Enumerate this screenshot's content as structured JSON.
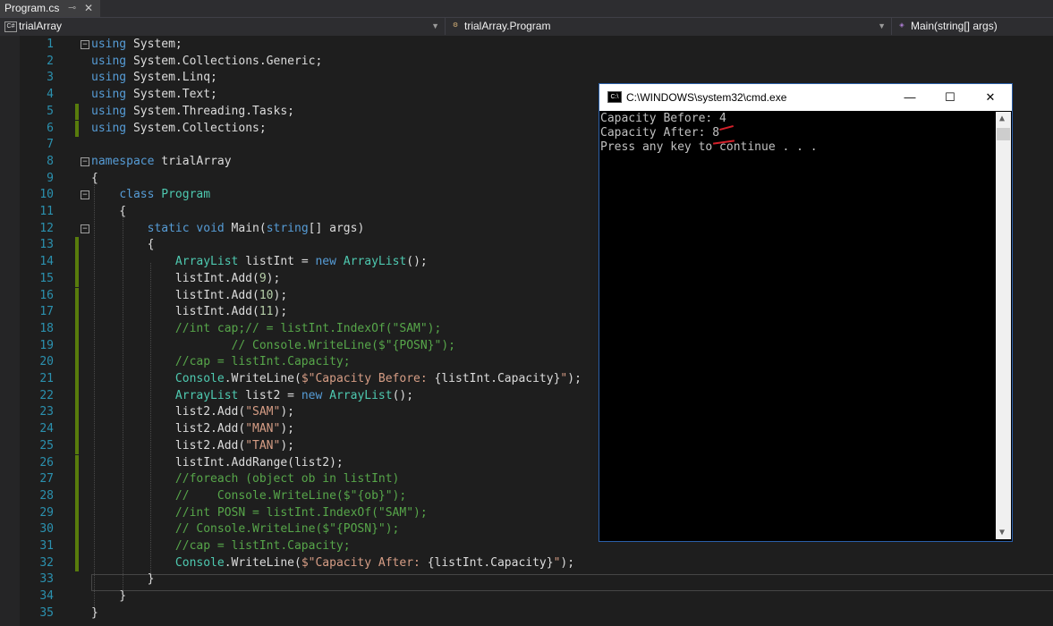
{
  "tab": {
    "title": "Program.cs",
    "pin": "⊸",
    "close": "✕"
  },
  "nav": {
    "project": "trialArray",
    "class": "trialArray.Program",
    "member": "Main(string[] args)",
    "project_icon": "C#"
  },
  "code_lines": [
    {
      "n": "1",
      "tokens": [
        [
          "k",
          "using"
        ],
        [
          "",
          "System;"
        ]
      ],
      "fold": "−",
      "chg": false
    },
    {
      "n": "2",
      "tokens": [
        [
          "k",
          "using"
        ],
        [
          "",
          "System.Collections.Generic;"
        ]
      ],
      "chg": false
    },
    {
      "n": "3",
      "tokens": [
        [
          "k",
          "using"
        ],
        [
          "",
          "System.Linq;"
        ]
      ],
      "chg": false
    },
    {
      "n": "4",
      "tokens": [
        [
          "k",
          "using"
        ],
        [
          "",
          "System.Text;"
        ]
      ],
      "chg": false
    },
    {
      "n": "5",
      "tokens": [
        [
          "k",
          "using"
        ],
        [
          "",
          "System.Threading.Tasks;"
        ]
      ],
      "chg": true
    },
    {
      "n": "6",
      "tokens": [
        [
          "k",
          "using"
        ],
        [
          "",
          "System.Collections;"
        ]
      ],
      "chg": true
    },
    {
      "n": "7",
      "tokens": [],
      "chg": false
    },
    {
      "n": "8",
      "tokens": [
        [
          "k",
          "namespace"
        ],
        [
          "",
          "trialArray"
        ]
      ],
      "fold": "−",
      "chg": false
    },
    {
      "n": "9",
      "tokens": [
        [
          "",
          "{"
        ]
      ],
      "chg": false
    },
    {
      "n": "10",
      "tokens": [
        [
          "",
          "    "
        ],
        [
          "k",
          "class"
        ],
        [
          "t",
          "Program"
        ]
      ],
      "fold": "−",
      "chg": false
    },
    {
      "n": "11",
      "tokens": [
        [
          "",
          "    {"
        ]
      ],
      "chg": false
    },
    {
      "n": "12",
      "tokens": [
        [
          "",
          "        "
        ],
        [
          "k",
          "static"
        ],
        [
          "k",
          "void"
        ],
        [
          "",
          "Main("
        ],
        [
          "k",
          "string"
        ],
        [
          "",
          "[] args)"
        ]
      ],
      "fold": "−",
      "chg": false
    },
    {
      "n": "13",
      "tokens": [
        [
          "",
          "        {"
        ]
      ],
      "chg": true
    },
    {
      "n": "14",
      "tokens": [
        [
          "",
          "            "
        ],
        [
          "t",
          "ArrayList"
        ],
        [
          "",
          "listInt ="
        ],
        [
          "k",
          "new"
        ],
        [
          "t",
          "ArrayList"
        ],
        [
          "",
          "();"
        ]
      ],
      "chg": true
    },
    {
      "n": "15",
      "tokens": [
        [
          "",
          "            listInt.Add("
        ],
        [
          "n",
          "9"
        ],
        [
          "",
          ");"
        ]
      ],
      "chg": true
    },
    {
      "n": "16",
      "tokens": [
        [
          "",
          "            listInt.Add("
        ],
        [
          "n",
          "10"
        ],
        [
          "",
          ");"
        ]
      ],
      "chg": true
    },
    {
      "n": "17",
      "tokens": [
        [
          "",
          "            listInt.Add("
        ],
        [
          "n",
          "11"
        ],
        [
          "",
          ");"
        ]
      ],
      "chg": true
    },
    {
      "n": "18",
      "tokens": [
        [
          "c",
          "            //int cap;// = listInt.IndexOf(\"SAM\");"
        ]
      ],
      "chg": true
    },
    {
      "n": "19",
      "tokens": [
        [
          "c",
          "                    // Console.WriteLine($\"{POSN}\");"
        ]
      ],
      "chg": true
    },
    {
      "n": "20",
      "tokens": [
        [
          "c",
          "            //cap = listInt.Capacity;"
        ]
      ],
      "chg": true
    },
    {
      "n": "21",
      "tokens": [
        [
          "",
          "            "
        ],
        [
          "t",
          "Console"
        ],
        [
          "",
          ".WriteLine("
        ],
        [
          "s",
          "$\"Capacity Before: "
        ],
        [
          "",
          "{listInt.Capacity}"
        ],
        [
          "s",
          "\""
        ],
        [
          "",
          ");"
        ]
      ],
      "chg": true
    },
    {
      "n": "22",
      "tokens": [
        [
          "",
          "            "
        ],
        [
          "t",
          "ArrayList"
        ],
        [
          "",
          "list2 ="
        ],
        [
          "k",
          "new"
        ],
        [
          "t",
          "ArrayList"
        ],
        [
          "",
          "();"
        ]
      ],
      "chg": true
    },
    {
      "n": "23",
      "tokens": [
        [
          "",
          "            list2.Add("
        ],
        [
          "s",
          "\"SAM\""
        ],
        [
          "",
          ");"
        ]
      ],
      "chg": true
    },
    {
      "n": "24",
      "tokens": [
        [
          "",
          "            list2.Add("
        ],
        [
          "s",
          "\"MAN\""
        ],
        [
          "",
          ");"
        ]
      ],
      "chg": true
    },
    {
      "n": "25",
      "tokens": [
        [
          "",
          "            list2.Add("
        ],
        [
          "s",
          "\"TAN\""
        ],
        [
          "",
          ");"
        ]
      ],
      "chg": true
    },
    {
      "n": "26",
      "tokens": [
        [
          "",
          "            listInt.AddRange(list2);"
        ]
      ],
      "chg": true
    },
    {
      "n": "27",
      "tokens": [
        [
          "c",
          "            //foreach (object ob in listInt)"
        ]
      ],
      "chg": true
    },
    {
      "n": "28",
      "tokens": [
        [
          "c",
          "            //    Console.WriteLine($\"{ob}\");"
        ]
      ],
      "chg": true
    },
    {
      "n": "29",
      "tokens": [
        [
          "c",
          "            //int POSN = listInt.IndexOf(\"SAM\");"
        ]
      ],
      "chg": true
    },
    {
      "n": "30",
      "tokens": [
        [
          "c",
          "            // Console.WriteLine($\"{POSN}\");"
        ]
      ],
      "chg": true
    },
    {
      "n": "31",
      "tokens": [
        [
          "c",
          "            //cap = listInt.Capacity;"
        ]
      ],
      "chg": true
    },
    {
      "n": "32",
      "tokens": [
        [
          "",
          "            "
        ],
        [
          "t",
          "Console"
        ],
        [
          "",
          ".WriteLine("
        ],
        [
          "s",
          "$\"Capacity After: "
        ],
        [
          "",
          "{listInt.Capacity}"
        ],
        [
          "s",
          "\""
        ],
        [
          "",
          ");"
        ]
      ],
      "chg": true
    },
    {
      "n": "33",
      "tokens": [
        [
          "",
          "        }"
        ]
      ],
      "chg": false
    },
    {
      "n": "34",
      "tokens": [
        [
          "",
          "    }"
        ]
      ],
      "chg": false
    },
    {
      "n": "35",
      "tokens": [
        [
          "",
          "}"
        ]
      ],
      "chg": false
    }
  ],
  "console": {
    "title": "C:\\WINDOWS\\system32\\cmd.exe",
    "icon": "C:\\",
    "minimize": "—",
    "maximize": "☐",
    "close": "✕",
    "output": "Capacity Before: 4\nCapacity After: 8\nPress any key to continue . . ."
  },
  "colors": {
    "keyword": "#569cd6",
    "type": "#4ec9b0",
    "string": "#d69d85",
    "comment": "#57a64a",
    "linenumber": "#2b91af",
    "change_bar": "#587c0c",
    "annotation": "#d4202a"
  }
}
